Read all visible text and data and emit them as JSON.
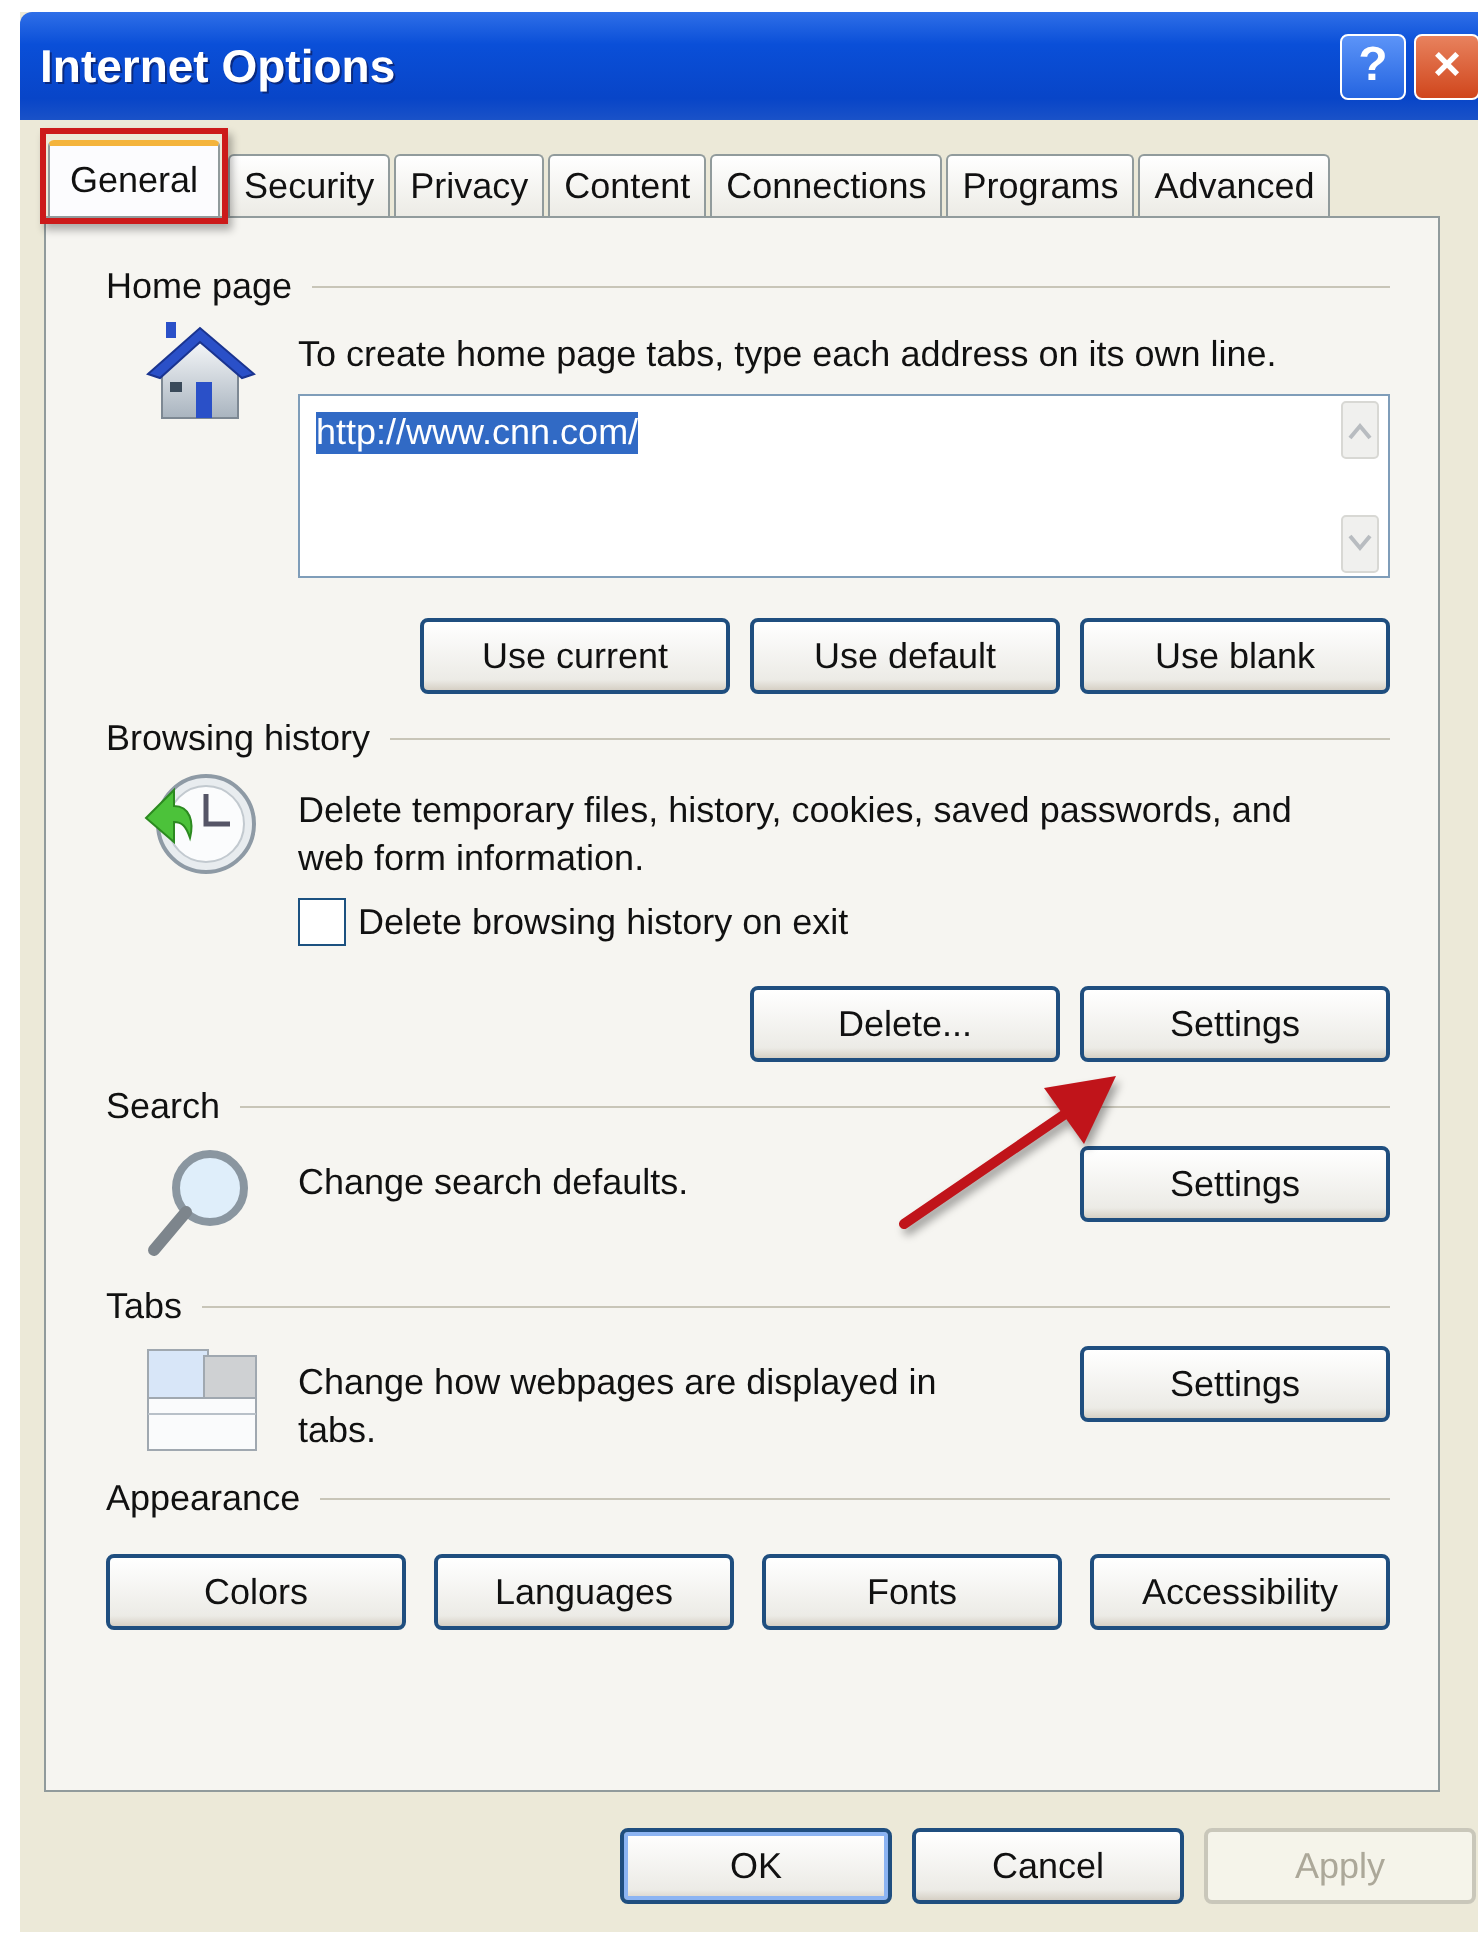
{
  "window": {
    "title": "Internet Options"
  },
  "title_buttons": [
    {
      "kind": "help",
      "label": "?"
    },
    {
      "kind": "close",
      "label": "×"
    }
  ],
  "tabs": [
    {
      "label": "General",
      "selected": true,
      "highlighted": true
    },
    {
      "label": "Security",
      "selected": false,
      "highlighted": false
    },
    {
      "label": "Privacy",
      "selected": false,
      "highlighted": false
    },
    {
      "label": "Content",
      "selected": false,
      "highlighted": false
    },
    {
      "label": "Connections",
      "selected": false,
      "highlighted": false
    },
    {
      "label": "Programs",
      "selected": false,
      "highlighted": false
    },
    {
      "label": "Advanced",
      "selected": false,
      "highlighted": false
    }
  ],
  "sections": [
    {
      "kind": "home",
      "heading": "Home page",
      "description": "To create home page tabs, type each address on its own line.",
      "addresses": "http://www.cnn.com/",
      "buttons": [
        "Use current",
        "Use default",
        "Use blank"
      ]
    },
    {
      "kind": "history",
      "heading": "Browsing history",
      "description": "Delete temporary files, history, cookies, saved passwords, and web form information.",
      "checkbox": {
        "label": "Delete browsing history on exit",
        "checked": false
      },
      "buttons": [
        "Delete...",
        "Settings"
      ]
    },
    {
      "kind": "row",
      "heading": "Search",
      "description": "Change search defaults.",
      "buttons": [
        "Settings"
      ]
    },
    {
      "kind": "row",
      "heading": "Tabs",
      "description": "Change how webpages are displayed in tabs.",
      "buttons": [
        "Settings"
      ]
    },
    {
      "kind": "buttons",
      "heading": "Appearance",
      "buttons": [
        "Colors",
        "Languages",
        "Fonts",
        "Accessibility"
      ]
    }
  ],
  "footer_buttons": [
    {
      "label": "OK",
      "disabled": false,
      "default": true
    },
    {
      "label": "Cancel",
      "disabled": false,
      "default": false
    },
    {
      "label": "Apply",
      "disabled": true,
      "default": false
    }
  ],
  "annotations": [
    {
      "kind": "arrow"
    }
  ]
}
